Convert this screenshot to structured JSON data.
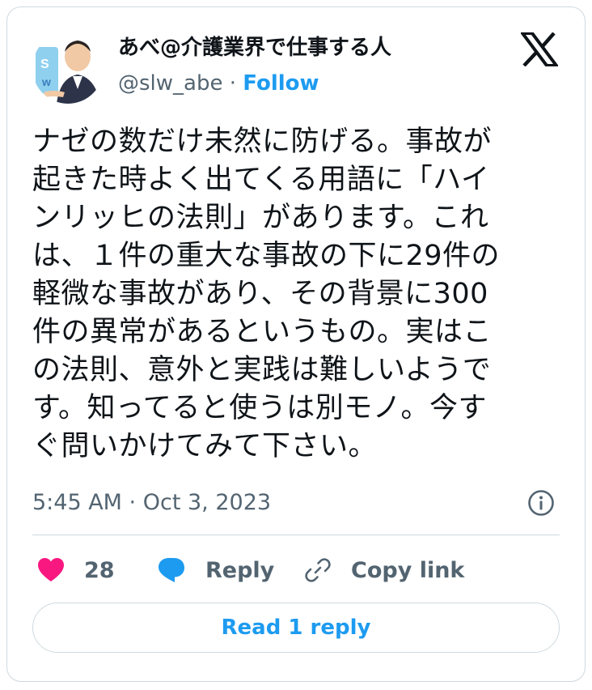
{
  "author": {
    "name": "あべ@介護業界で仕事する人",
    "handle": "@slw_abe",
    "separator": "·",
    "follow_label": "Follow"
  },
  "tweet": {
    "text": "ナゼの数だけ未然に防げる。事故が\n起きた時よく出てくる用語に「ハイ\nンリッヒの法則」があります。これ\nは、１件の重大な事故の下に29件の\n軽微な事故があり、その背景に300\n件の異常があるというもの。実はこ\nの法則、意外と実践は難しいようで\nす。知ってると使うは別モノ。今す\nぐ問いかけてみて下さい。",
    "timestamp": "5:45 AM · Oct 3, 2023"
  },
  "actions": {
    "like_count": "28",
    "reply_label": "Reply",
    "copy_link_label": "Copy link"
  },
  "read_replies_label": "Read 1 reply",
  "icons": {
    "brand": "x-logo-icon",
    "info": "info-icon",
    "like": "heart-icon",
    "reply": "speech-bubble-icon",
    "copy": "link-icon"
  },
  "colors": {
    "accent": "#1d9bf0",
    "like": "#f91880",
    "text": "#0f1419",
    "muted": "#536471",
    "border": "#cfd9de"
  }
}
